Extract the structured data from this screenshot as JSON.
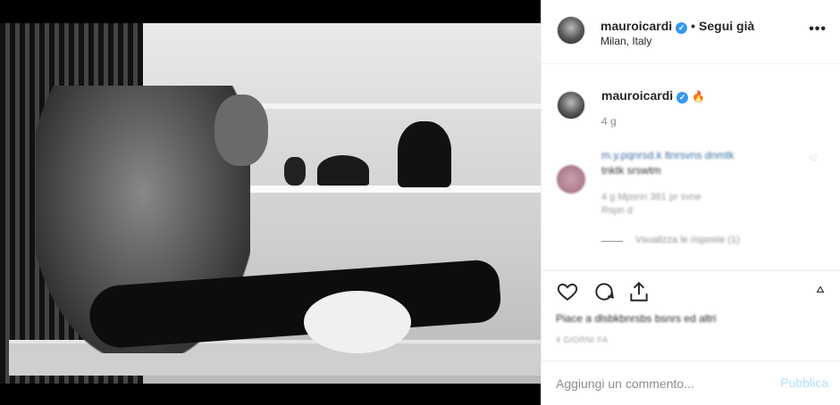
{
  "post": {
    "username": "mauroicardi",
    "follow_status": "Segui già",
    "separator": "•",
    "location": "Milan, Italy",
    "more": "•••"
  },
  "caption": {
    "username": "mauroicardi",
    "emoji": "🔥",
    "time": "4 g"
  },
  "comment": {
    "line1": "m.y.pqnrsd.k ltnrsvns  dnmtk",
    "line2": "tnktk srswtm",
    "meta1": "4 g   Mpsnn 381 pr svne",
    "meta2": "Rspn d",
    "replies": "Vsualizza le risposte (1)"
  },
  "stats": {
    "likes_text": "Piace a dlsbkbnrsbs bsnrs ed altri",
    "date_text": "4 GIORNI FA"
  },
  "add_comment": {
    "placeholder": "Aggiungi un commento...",
    "publish_label": "Pubblica"
  },
  "colors": {
    "verified": "#3897f0",
    "publish": "#b2dffc",
    "muted": "#8e8e8e"
  }
}
